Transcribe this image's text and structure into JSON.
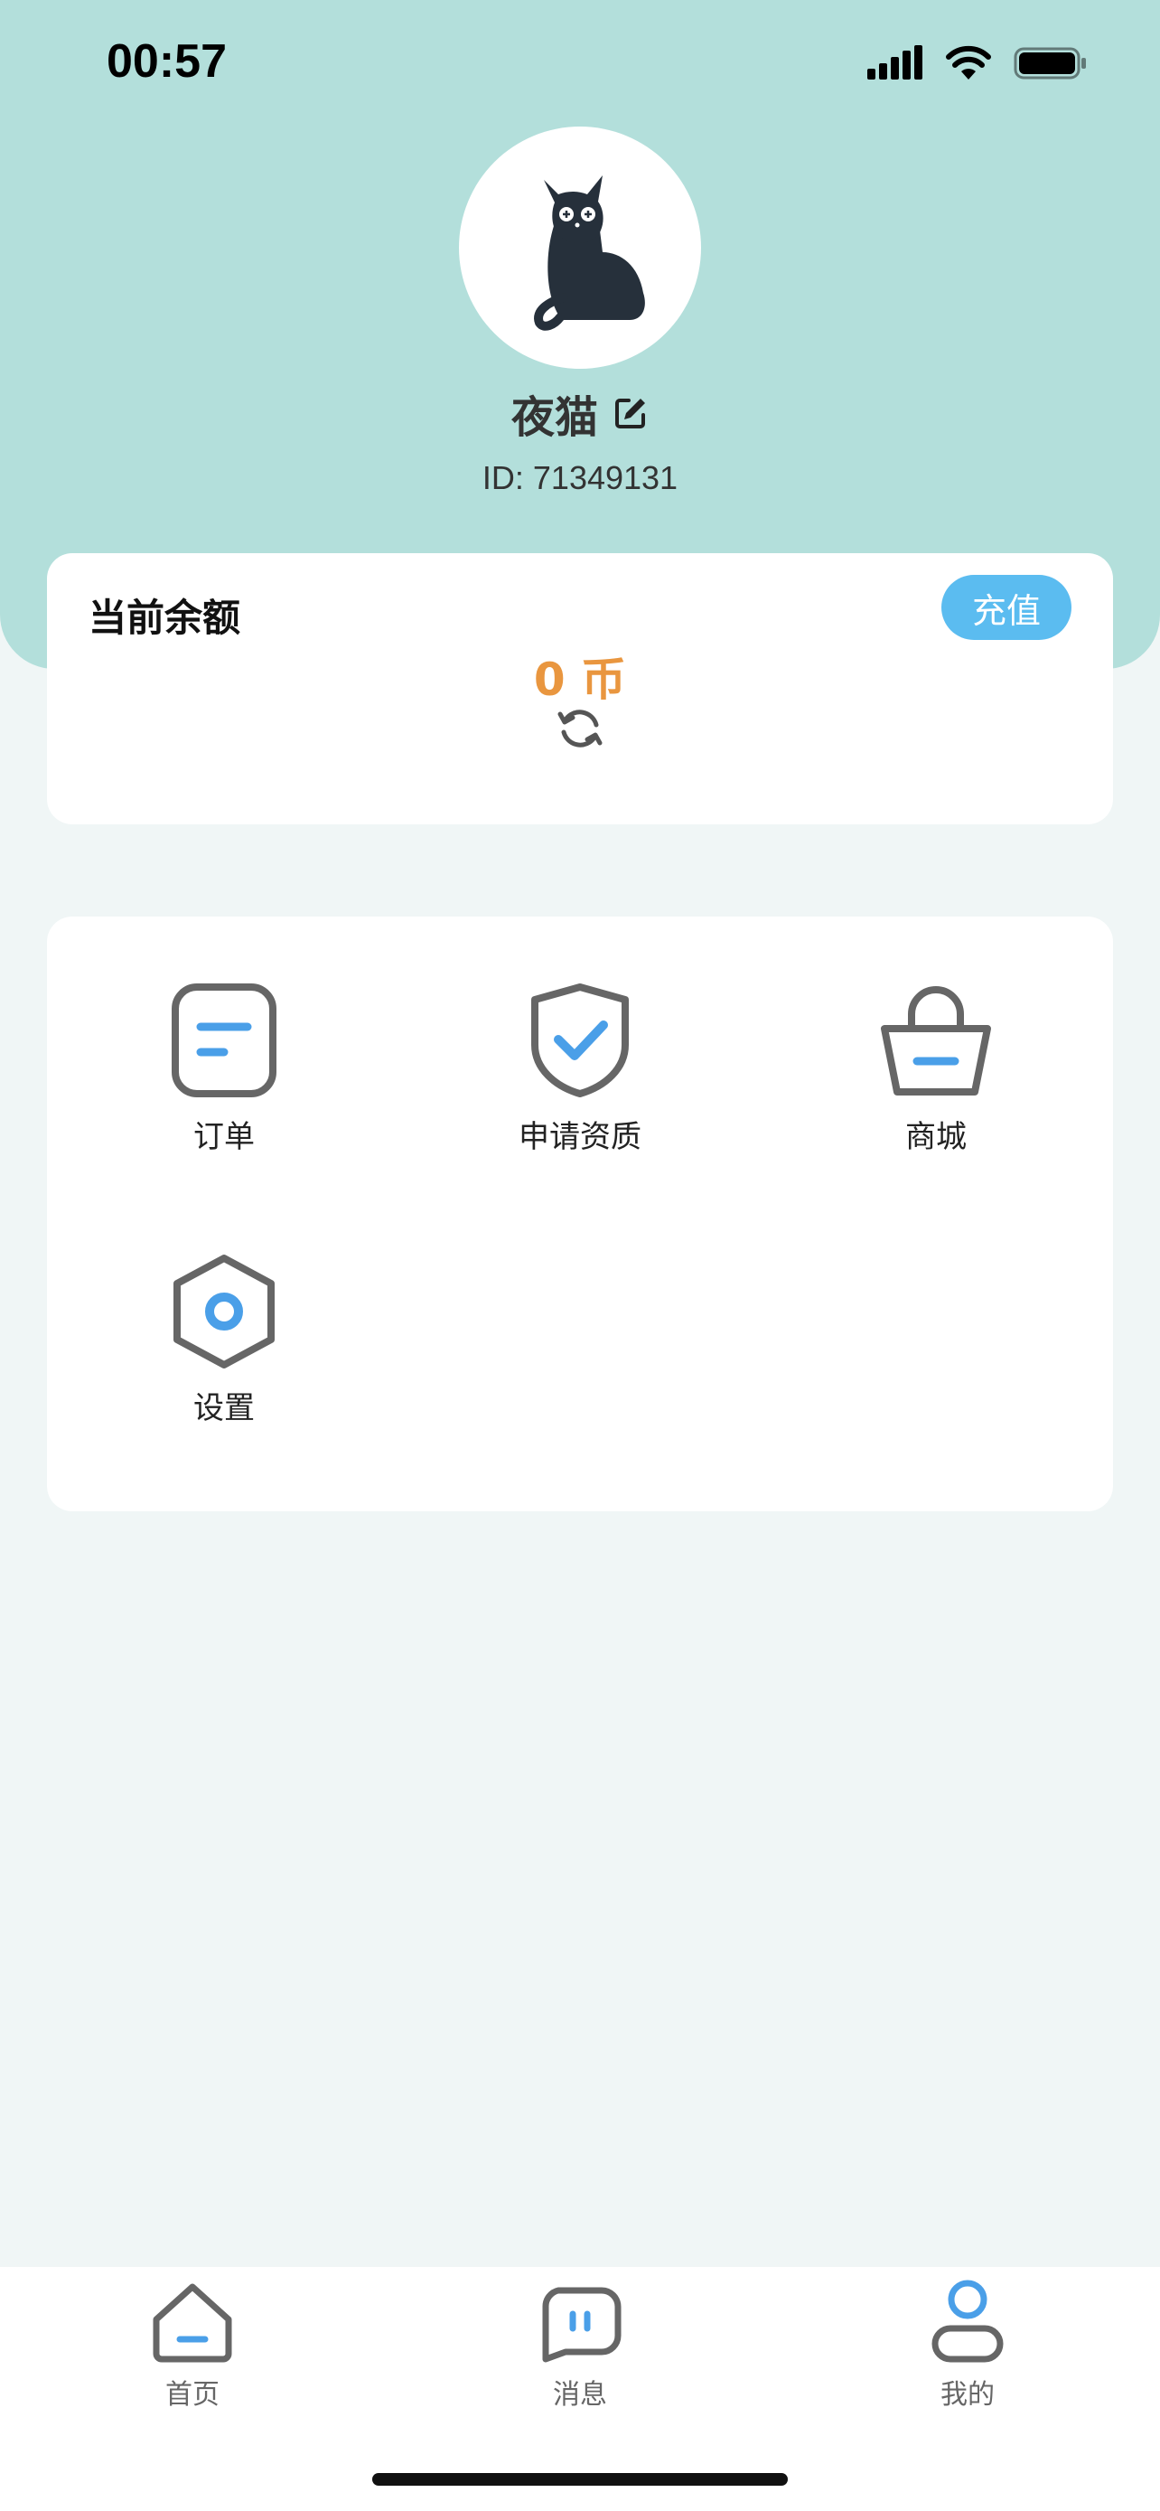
{
  "status_bar": {
    "time": "00:57"
  },
  "profile": {
    "name": "夜猫",
    "id_text": "ID: 71349131"
  },
  "balance": {
    "title": "当前余额",
    "amount": "0 币",
    "recharge_label": "充值"
  },
  "menu": {
    "items": [
      {
        "label": "订单",
        "icon": "order-icon"
      },
      {
        "label": "申请资质",
        "icon": "shield-check-icon"
      },
      {
        "label": "商城",
        "icon": "shopping-bag-icon"
      },
      {
        "label": "设置",
        "icon": "settings-hexagon-icon"
      }
    ]
  },
  "bottom_nav": {
    "items": [
      {
        "label": "首页",
        "icon": "home-icon"
      },
      {
        "label": "消息",
        "icon": "message-icon"
      },
      {
        "label": "我的",
        "icon": "profile-icon",
        "active": true
      }
    ]
  },
  "colors": {
    "header_bg": "#b3dfdb",
    "page_bg": "#f0f6f6",
    "accent_blue": "#5bbcf0",
    "icon_blue": "#4a9fe8",
    "icon_gray": "#666666",
    "amount_orange": "#e9963f"
  }
}
